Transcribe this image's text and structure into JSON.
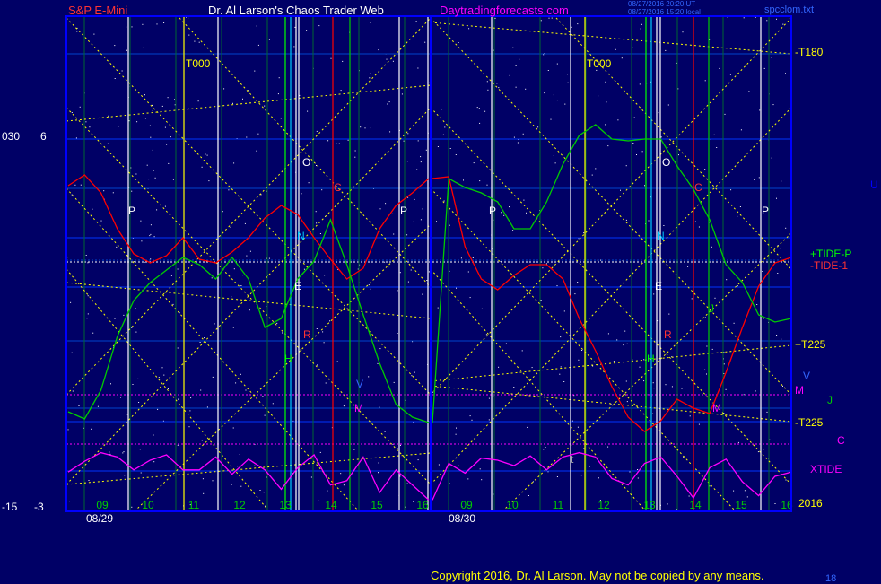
{
  "header": {
    "symbol": "S&P E-Mini",
    "site_title": "Dr. Al Larson's Chaos Trader Web",
    "site_url": "Daytradingforecasts.com",
    "timestamp_1": "08/27/2016 20:20 UT",
    "timestamp_2": "08/27/2016 15:20 local",
    "file_name": "spcclom.txt"
  },
  "left_axis": {
    "top_outer": "030",
    "top_inner": "6",
    "bottom_outer": "-15",
    "bottom_inner": "-3"
  },
  "right_labels": {
    "t180": "-T180",
    "tide_p": "+TIDE-P",
    "tide_1": "-TIDE-1",
    "t225_plus": "+T225",
    "v": "V",
    "m": "M",
    "j": "J",
    "t225_minus": "-T225",
    "c": "C",
    "xtide": "XTIDE",
    "year": "2016",
    "u": "U"
  },
  "copyright": "Copyright 2016, Dr. Al Larson. May not be copied by any means.",
  "corner_number": "18",
  "colors": {
    "background": "#000066",
    "plot_border": "#0000ff",
    "price_line": "#ff0000",
    "tide_line": "#00cc00",
    "xtide_line": "#ff00ff",
    "grid_diag": "#ffff00"
  },
  "chart_data": {
    "type": "line",
    "dates": [
      "08/29",
      "08/30"
    ],
    "hour_ticks": [
      [
        "09",
        "10",
        "11",
        "12",
        "13",
        "14",
        "15",
        "16"
      ],
      [
        "09",
        "10",
        "11",
        "12",
        "13",
        "14",
        "15",
        "16"
      ]
    ],
    "time_markers": [
      "T000",
      "T000"
    ],
    "planet_markers": [
      [
        "P",
        "O",
        "N",
        "E",
        "H",
        "R",
        "C",
        "V",
        "M",
        "P"
      ],
      [
        "P",
        "O",
        "N",
        "E",
        "H",
        "R",
        "C",
        "M",
        "P",
        "t",
        "J"
      ]
    ],
    "series": [
      {
        "name": "-TIDE-1",
        "values": [
          0.74,
          0.8,
          0.7,
          0.5,
          0.36,
          0.31,
          0.35,
          0.45,
          0.33,
          0.31,
          0.37,
          0.45,
          0.56,
          0.63,
          0.58,
          0.45,
          0.33,
          0.22,
          0.28,
          0.5,
          0.63,
          0.7,
          0.78,
          0.79,
          0.4,
          0.22,
          0.16,
          0.24,
          0.3,
          0.3,
          0.22,
          0.0,
          -0.18,
          -0.38,
          -0.55,
          -0.63,
          -0.57,
          -0.45,
          -0.5,
          -0.53,
          -0.3,
          -0.05,
          0.18,
          0.31,
          0.34
        ]
      },
      {
        "name": "+TIDE-P",
        "values": [
          -0.52,
          -0.56,
          -0.4,
          -0.1,
          0.1,
          0.2,
          0.27,
          0.34,
          0.3,
          0.22,
          0.34,
          0.22,
          -0.05,
          0.0,
          0.22,
          0.32,
          0.55,
          0.3,
          0.02,
          -0.25,
          -0.48,
          -0.55,
          -0.58,
          0.78,
          0.73,
          0.7,
          0.65,
          0.5,
          0.5,
          0.65,
          0.86,
          1.02,
          1.08,
          1.0,
          0.99,
          1.0,
          1.0,
          0.85,
          0.72,
          0.55,
          0.3,
          0.2,
          0.02,
          -0.02,
          0.0
        ]
      },
      {
        "name": "XTIDE",
        "values": [
          -0.84,
          -0.94,
          -1.02,
          -0.98,
          -0.86,
          -0.95,
          -1.0,
          -0.86,
          -0.86,
          -0.98,
          -0.82,
          -0.96,
          -0.86,
          -0.68,
          -0.88,
          -1.0,
          -0.72,
          -0.76,
          -0.98,
          -0.65,
          -0.86,
          -0.72,
          -0.58,
          -0.92,
          -0.83,
          -0.97,
          -0.95,
          -0.9,
          -0.99,
          -0.86,
          -0.98,
          -1.02,
          -0.98,
          -0.78,
          -0.72,
          -0.92,
          -0.98,
          -0.8,
          -0.6,
          -0.88,
          -0.96,
          -0.75,
          -0.62,
          -0.8,
          -0.84
        ]
      }
    ],
    "xlabel": "",
    "ylabel": ""
  }
}
